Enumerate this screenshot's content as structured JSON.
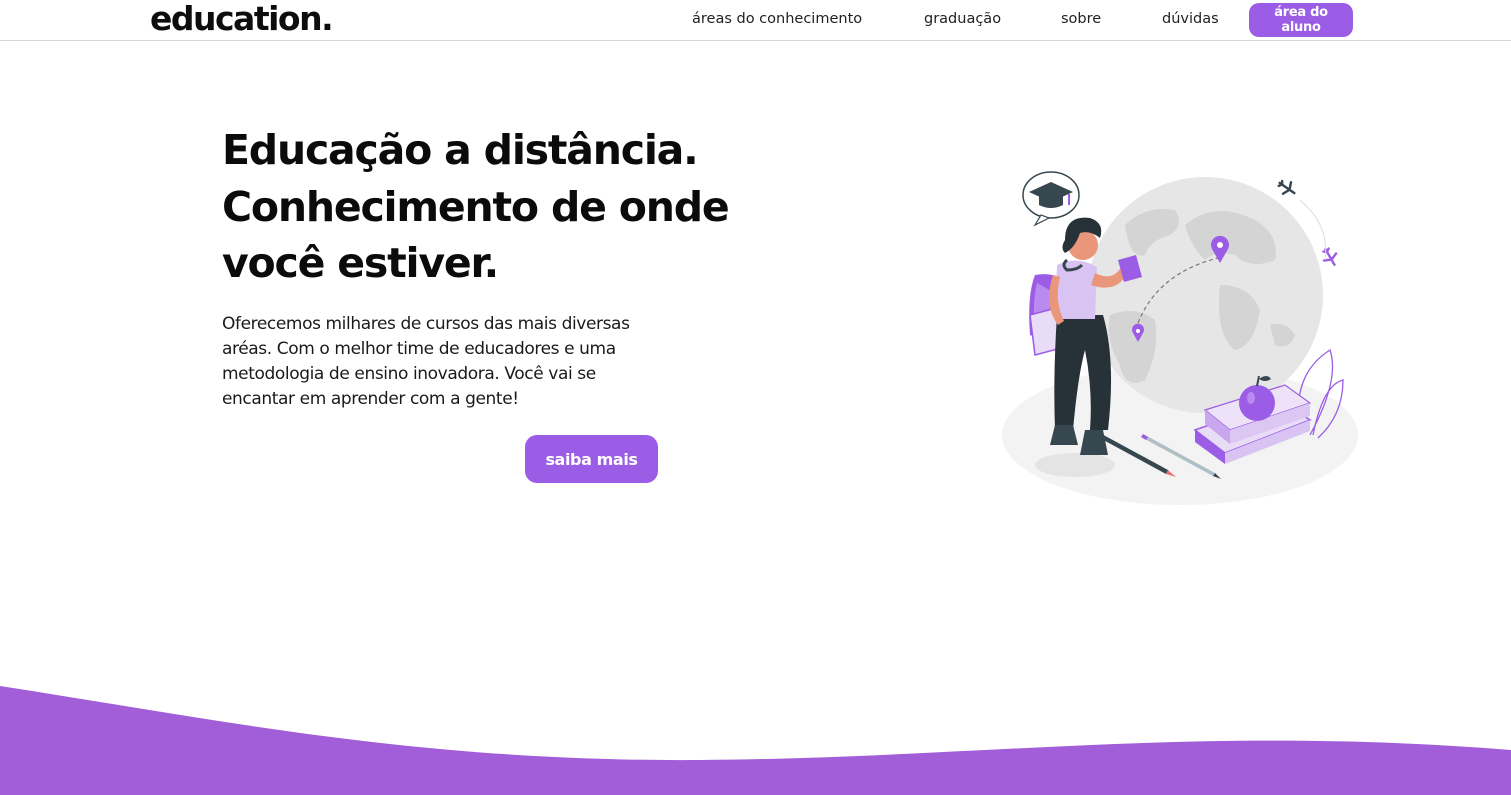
{
  "header": {
    "logo": "education.",
    "nav": [
      {
        "label": "áreas do conhecimento"
      },
      {
        "label": "graduação"
      },
      {
        "label": "sobre"
      },
      {
        "label": "dúvidas"
      }
    ],
    "cta_label": "área do aluno"
  },
  "hero": {
    "title_lines": [
      "Educação a distância.",
      "Conhecimento de onde",
      "você estiver."
    ],
    "text_lines": [
      "Oferecemos milhares de cursos das mais diversas",
      "aréas. Com o melhor time de educadores e uma",
      "metodologia de ensino inovadora. Você vai se",
      "encantar em aprender com a gente!"
    ],
    "button_label": "saiba mais"
  },
  "colors": {
    "accent": "#9b5de5",
    "wave": "#a25ed9",
    "text": "#0b0b0b"
  },
  "illustration": {
    "icons": [
      "globe-icon",
      "graduation-cap-icon",
      "airplane-icon",
      "map-pin-icon",
      "book-icon",
      "apple-icon",
      "pencil-icon",
      "student-figure"
    ]
  }
}
